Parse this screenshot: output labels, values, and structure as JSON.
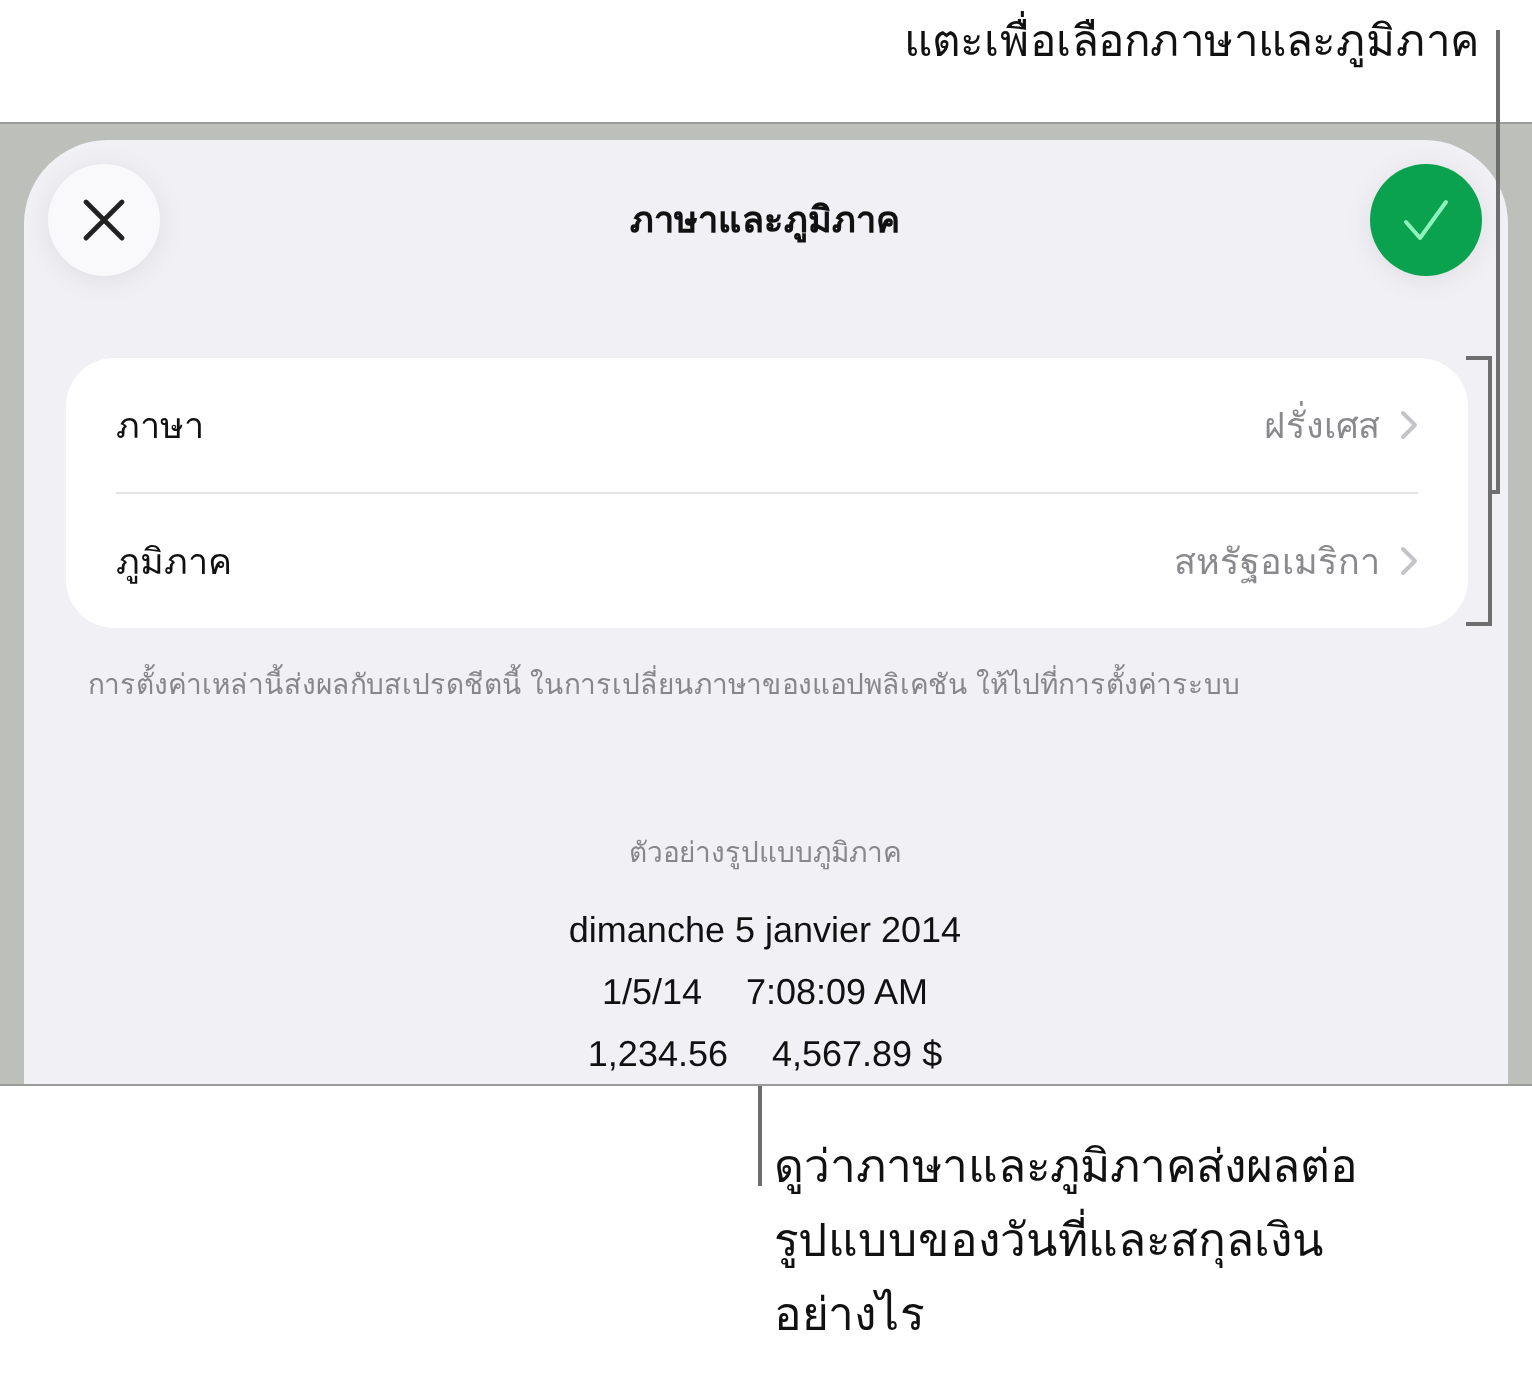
{
  "top_callout": "แตะเพื่อเลือกภาษาและภูมิภาค",
  "sheet": {
    "title": "ภาษาและภูมิภาค"
  },
  "settings": [
    {
      "label": "ภาษา",
      "value": "ฝรั่งเศส"
    },
    {
      "label": "ภูมิภาค",
      "value": "สหรัฐอเมริกา"
    }
  ],
  "footnote": "การตั้งค่าเหล่านี้ส่งผลกับสเปรดชีตนี้ ในการเปลี่ยนภาษาของแอปพลิเคชัน ให้ไปที่การตั้งค่าระบบ",
  "preview": {
    "heading": "ตัวอย่างรูปแบบภูมิภาค",
    "date": "dimanche 5 janvier 2014",
    "lines": [
      [
        "1/5/14",
        "7:08:09 AM"
      ],
      [
        "1,234.56",
        "4,567.89 $"
      ]
    ]
  },
  "bottom_callout": "ดูว่าภาษาและภูมิภาคส่งผลต่อ\nรูปแบบของวันที่และสกุลเงิน\nอย่างไร"
}
